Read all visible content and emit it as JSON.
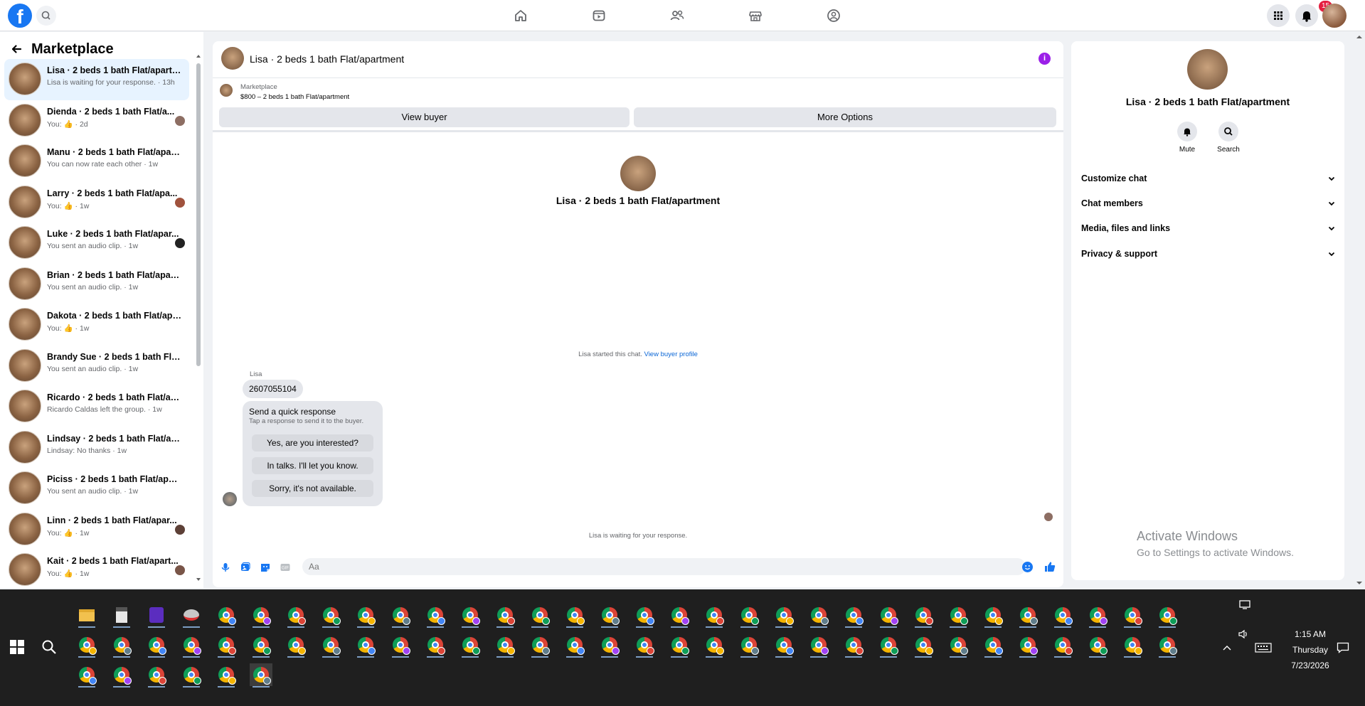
{
  "nav": {
    "logo": "f",
    "notification_count": "15"
  },
  "sidebar": {
    "title": "Marketplace",
    "conversations": [
      {
        "title": "Lisa · 2 beds 1 bath Flat/apartm...",
        "subtitle": "Lisa is waiting for your response. · 13h"
      },
      {
        "title": "Dienda · 2 beds 1 bath Flat/a...",
        "subtitle": "You: 👍 · 2d"
      },
      {
        "title": "Manu · 2 beds 1 bath Flat/apart...",
        "subtitle": "You can now rate each other · 1w"
      },
      {
        "title": "Larry · 2 beds 1 bath Flat/apa...",
        "subtitle": "You: 👍 · 1w"
      },
      {
        "title": "Luke · 2 beds 1 bath Flat/apar...",
        "subtitle": "You sent an audio clip. · 1w"
      },
      {
        "title": "Brian · 2 beds 1 bath Flat/apart...",
        "subtitle": "You sent an audio clip. · 1w"
      },
      {
        "title": "Dakota · 2 beds 1 bath Flat/apar...",
        "subtitle": "You: 👍 · 1w"
      },
      {
        "title": "Brandy Sue · 2 beds 1 bath Flat/...",
        "subtitle": "You sent an audio clip. · 1w"
      },
      {
        "title": "Ricardo · 2 beds 1 bath Flat/apa...",
        "subtitle": "Ricardo Caldas left the group. · 1w"
      },
      {
        "title": "Lindsay · 2 beds 1 bath Flat/apa...",
        "subtitle": "Lindsay: No thanks · 1w"
      },
      {
        "title": "Piciss · 2 beds 1 bath Flat/apart...",
        "subtitle": "You sent an audio clip. · 1w"
      },
      {
        "title": "Linn · 2 beds 1 bath Flat/apar...",
        "subtitle": "You: 👍 · 1w"
      },
      {
        "title": "Kait · 2 beds 1 bath Flat/apart...",
        "subtitle": "You: 👍 · 1w"
      }
    ]
  },
  "chat": {
    "title": "Lisa · 2 beds 1 bath Flat/apartment",
    "listing_label": "Marketplace",
    "listing_price": "$800 – 2 beds 1 bath Flat/apartment",
    "view_buyer_label": "View buyer",
    "more_options_label": "More Options",
    "center_name": "Lisa · 2 beds 1 bath Flat/apartment",
    "started_text": "Lisa started this chat.",
    "view_profile_link": "View buyer profile",
    "sender_name": "Lisa",
    "message_text": "2607055104",
    "quick_title": "Send a quick response",
    "quick_subtitle": "Tap a response to send it to the buyer.",
    "quick_responses": [
      "Yes, are you interested?",
      "In talks. I'll let you know.",
      "Sorry, it's not available."
    ],
    "waiting_text": "Lisa is waiting for your response.",
    "composer_placeholder": "Aa"
  },
  "rpanel": {
    "name": "Lisa · 2 beds 1 bath Flat/apartment",
    "mute_label": "Mute",
    "search_label": "Search",
    "sections": [
      "Customize chat",
      "Chat members",
      "Media, files and links",
      "Privacy & support"
    ]
  },
  "watermark": {
    "line1": "Activate Windows",
    "line2": "Go to Settings to activate Windows."
  },
  "taskbar": {
    "time": "1:15 AM",
    "day": "Thursday",
    "date": "7/23/2026"
  },
  "colors": {
    "brand": "#1877f2",
    "info": "#9b1fe8",
    "badge": "#e41e3f",
    "link": "#0a66d6"
  }
}
